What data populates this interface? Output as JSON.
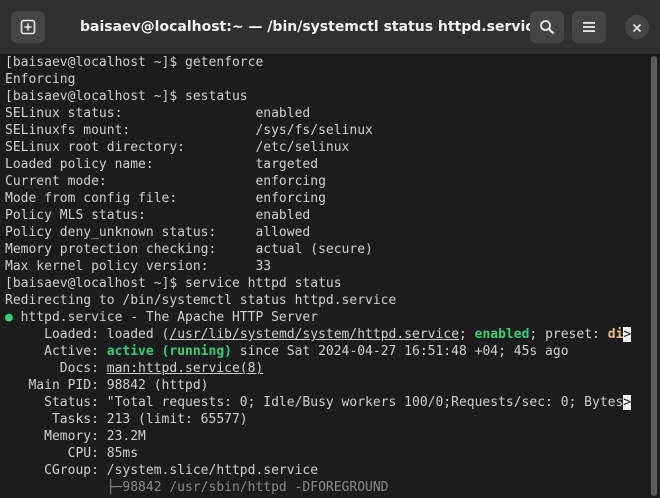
{
  "window": {
    "title": "baisaev@localhost:~ — /bin/systemctl status httpd.service"
  },
  "titlebar": {
    "new_tab_icon": "new-tab-icon",
    "search_icon": "search-icon",
    "menu_icon": "hamburger-menu-icon",
    "close_icon": "close-icon"
  },
  "colors": {
    "active_green": "#33d17a",
    "enabled_green": "#33d17a",
    "preset_yellow": "#e5c07b"
  },
  "terminal": {
    "l01": "[baisaev@localhost ~]$ getenforce",
    "l02": "Enforcing",
    "l03": "[baisaev@localhost ~]$ sestatus",
    "l04": "SELinux status:                 enabled",
    "l05": "SELinuxfs mount:                /sys/fs/selinux",
    "l06": "SELinux root directory:         /etc/selinux",
    "l07": "Loaded policy name:             targeted",
    "l08": "Current mode:                   enforcing",
    "l09": "Mode from config file:          enforcing",
    "l10": "Policy MLS status:              enabled",
    "l11": "Policy deny_unknown status:     allowed",
    "l12": "Memory protection checking:     actual (secure)",
    "l13": "Max kernel policy version:      33",
    "l14": "[baisaev@localhost ~]$ service httpd status",
    "l15": "Redirecting to /bin/systemctl status httpd.service",
    "l16_dot": "●",
    "l16": " httpd.service - The Apache HTTP Server",
    "l17_pre": "     Loaded: loaded (",
    "l17_path": "/usr/lib/systemd/system/httpd.service",
    "l17_mid": "; ",
    "l17_enabled": "enabled",
    "l17_post": "; preset: ",
    "l17_di": "di",
    "l17_trunc": ">",
    "l18_pre": "     Active: ",
    "l18_active": "active (running)",
    "l18_post": " since Sat 2024-04-27 16:51:48 +04; 45s ago",
    "l19_pre": "       Docs: ",
    "l19_docs": "man:httpd.service(8)",
    "l20": "   Main PID: 98842 (httpd)",
    "l21": "     Status: \"Total requests: 0; Idle/Busy workers 100/0;Requests/sec: 0; Bytes",
    "l21_trunc": ">",
    "l22": "      Tasks: 213 (limit: 65577)",
    "l23": "     Memory: 23.2M",
    "l24": "        CPU: 85ms",
    "l25": "     CGroup: /system.slice/httpd.service",
    "l26": "             ├─98842 /usr/sbin/httpd -DFOREGROUND"
  }
}
